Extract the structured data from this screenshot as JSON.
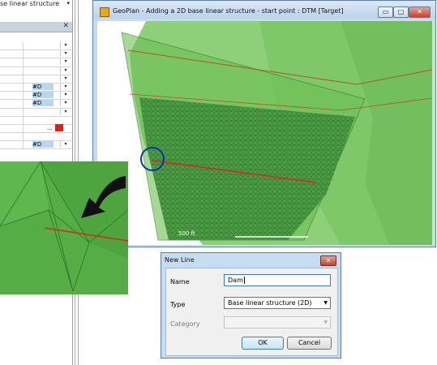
{
  "left_panel": {
    "header_text": "se linear structure",
    "header_dropdown_icon": "chevron-down-icon",
    "panel_close_icon": "close-icon",
    "rows": [
      {
        "value": "",
        "dropdown": "▾"
      },
      {
        "value": "",
        "dropdown": "▾"
      },
      {
        "value": "",
        "dropdown": "▾"
      },
      {
        "value": "",
        "dropdown": "▾"
      },
      {
        "value": "",
        "dropdown": "▾"
      },
      {
        "value": "#D",
        "dropdown": "▾"
      },
      {
        "value": "#D",
        "dropdown": "▾"
      },
      {
        "value": "#D",
        "dropdown": "▾"
      },
      {
        "value": "",
        "dropdown": "▾"
      },
      {
        "value": "",
        "dropdown": ""
      },
      {
        "value": "",
        "dropdown": "",
        "dots": "...",
        "swatch": "#e02010"
      },
      {
        "value": "",
        "dropdown": ""
      },
      {
        "value": "#D",
        "dropdown": "▾"
      }
    ]
  },
  "map_window": {
    "title": "GeoPlan - Adding a 2D base linear structure - start point : DTM  [Target]",
    "app_icon": "geoplan-icon",
    "minimize_label": "▭",
    "maximize_label": "□",
    "close_label": "✕",
    "scale_label": "500 ft",
    "terrain_color": "#6cbf52",
    "mesh_color": "#3f8f3a",
    "line_color": "#e0261b",
    "marker_color": "#1030b0"
  },
  "callout": {
    "arrow_icon": "curved-arrow-icon"
  },
  "new_line_dialog": {
    "title": "New Line",
    "close_label": "✕",
    "name_label": "Name",
    "name_value": "Dam",
    "type_label": "Type",
    "type_value": "Base linear structure (2D)",
    "category_label": "Category",
    "category_value": "",
    "ok_label": "OK",
    "cancel_label": "Cancel"
  }
}
